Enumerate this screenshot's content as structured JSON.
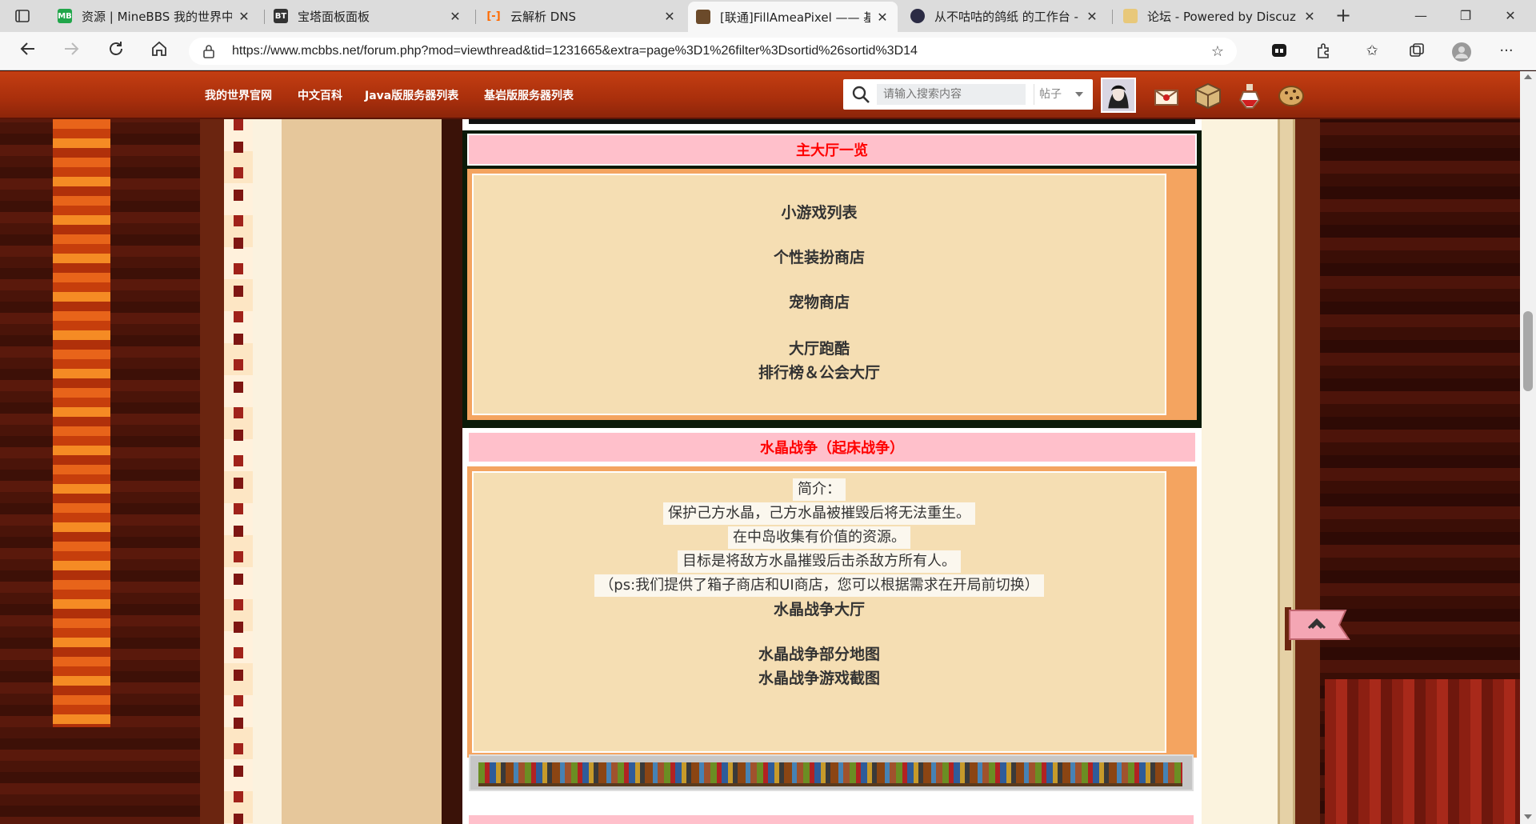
{
  "browser": {
    "tabs": [
      {
        "title": "资源 | MineBBS 我的世界中",
        "favicon": "MB",
        "favicon_color": "#21a64a"
      },
      {
        "title": "宝塔面板面板",
        "favicon": "BT",
        "favicon_color": "#333333"
      },
      {
        "title": "云解析 DNS",
        "favicon": "[-]",
        "favicon_color": "#ff6a00"
      },
      {
        "title": "[联通]FillAmeaPixel —— 基",
        "favicon": "block",
        "favicon_color": "#6b4a2a"
      },
      {
        "title": "从不咕咕的鸽纸 的工作台 -",
        "favicon": "bili",
        "favicon_color": "#2b2b44"
      },
      {
        "title": "论坛 - Powered by Discuz!",
        "favicon": "folder",
        "favicon_color": "#e8c87a"
      }
    ],
    "url": "https://www.mcbbs.net/forum.php?mod=viewthread&tid=1231665&extra=page%3D1%26filter%3Dsortid%26sortid%3D14",
    "icons": [
      "back-icon",
      "forward-icon",
      "refresh-icon",
      "home-icon",
      "lock-icon",
      "add-favorite-icon",
      "extensions-icon",
      "favorites-icon",
      "collections-icon",
      "profile-icon",
      "more-icon"
    ]
  },
  "site_nav": {
    "links": [
      "我的世界官网",
      "中文百科",
      "Java版服务器列表",
      "基岩版服务器列表"
    ],
    "search": {
      "placeholder": "请输入搜索内容",
      "type": "帖子"
    }
  },
  "posts": [
    {
      "heading": "主大厅一览",
      "lines": [
        "小游戏列表",
        "个性装扮商店",
        "宠物商店",
        "大厅跑酷",
        "排行榜＆公会大厅"
      ]
    },
    {
      "heading": "水晶战争（起床战争）",
      "intro": [
        "简介：",
        "保护己方水晶，己方水晶被摧毁后将无法重生。",
        "在中岛收集有价值的资源。",
        "目标是将敌方水晶摧毁后击杀敌方所有人。",
        "（ps:我们提供了箱子商店和UI商店，您可以根据需求在开局前切换）"
      ],
      "lines": [
        "水晶战争大厅",
        "水晶战争部分地图",
        "水晶战争游戏截图"
      ]
    }
  ],
  "colors": {
    "heading_bg": "#ffc0cb",
    "heading_text": "#ff0000",
    "frame": "#f4a460",
    "body_bg": "#f5deb3",
    "nav_bg": "#b0340d"
  }
}
